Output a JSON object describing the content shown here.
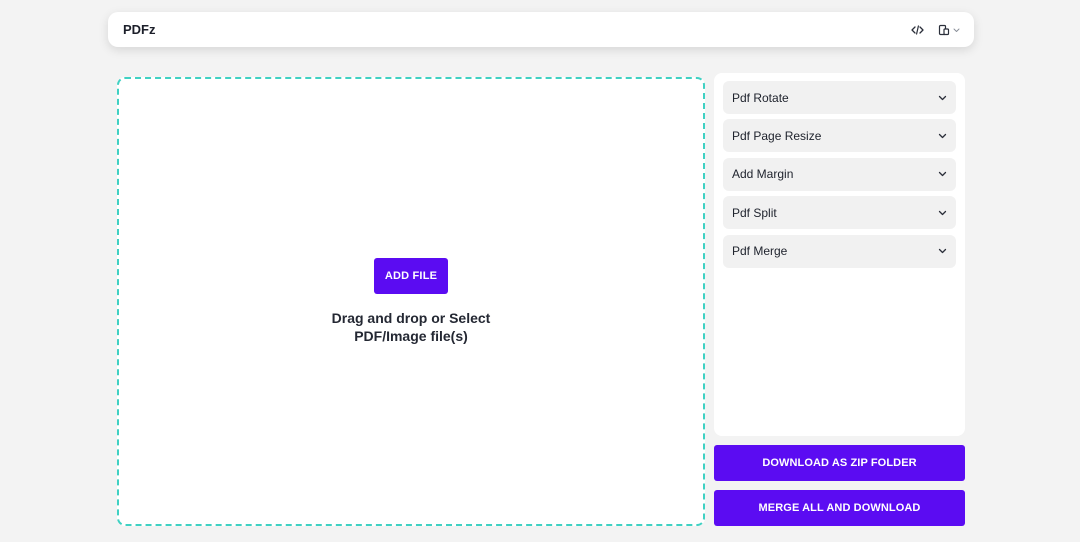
{
  "app": {
    "title": "PDFz"
  },
  "header": {
    "icons": [
      "code-icon",
      "theme-icon"
    ]
  },
  "dropzone": {
    "add_file_label": "ADD FILE",
    "instruction_line1": "Drag and drop or Select",
    "instruction_line2": "PDF/Image file(s)"
  },
  "tools": {
    "items": [
      {
        "label": "Pdf Rotate"
      },
      {
        "label": "Pdf Page Resize"
      },
      {
        "label": "Add Margin"
      },
      {
        "label": "Pdf Split"
      },
      {
        "label": "Pdf Merge"
      }
    ]
  },
  "actions": {
    "download_zip_label": "DOWNLOAD AS ZIP FOLDER",
    "merge_download_label": "MERGE ALL AND DOWNLOAD"
  },
  "colors": {
    "accent": "#5b0cf2",
    "dropzone_border": "#3fd1c3",
    "background": "#f3f3f3"
  }
}
